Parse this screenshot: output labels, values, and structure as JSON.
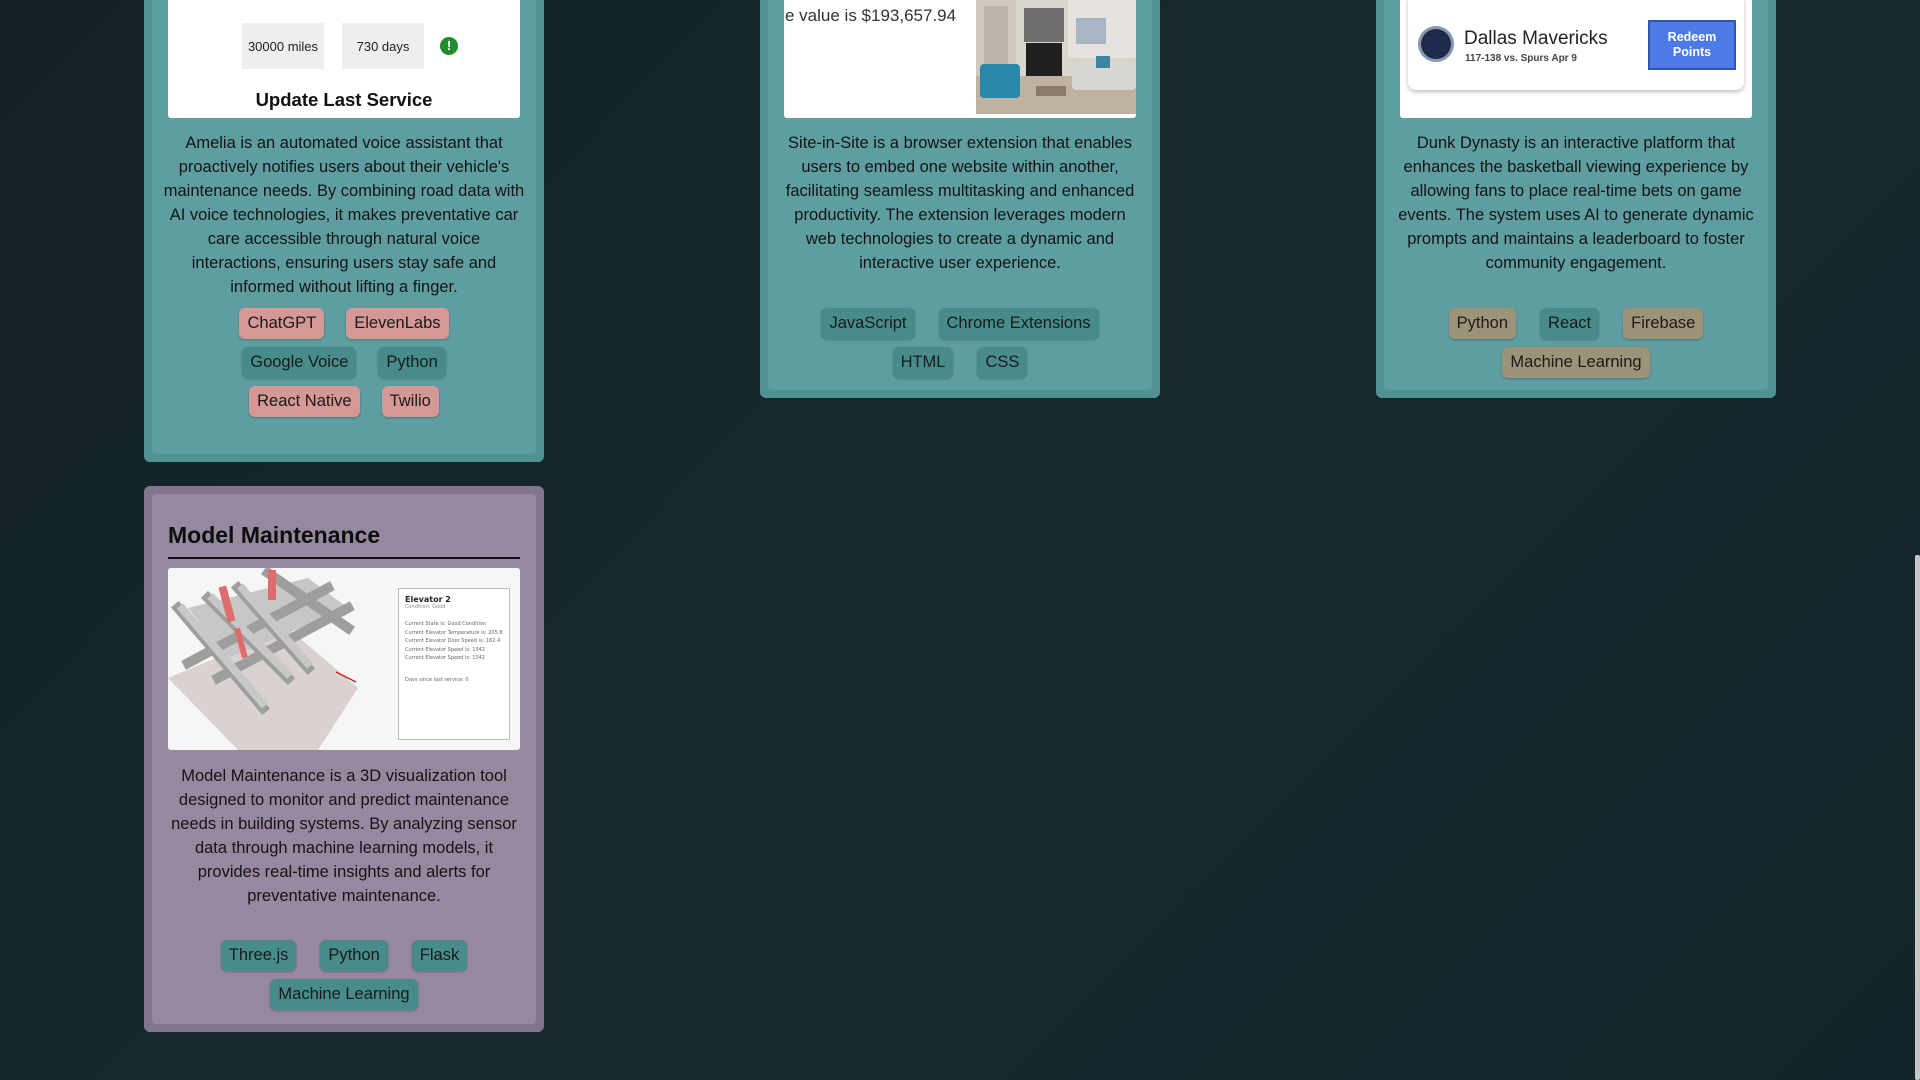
{
  "cards": {
    "amelia": {
      "preview": {
        "mileage": "30000 miles",
        "days": "730 days",
        "button": "Update Last Service"
      },
      "description": "Amelia is an automated voice assistant that proactively notifies users about their vehicle's maintenance needs. By combining road data with AI voice technologies, it makes preventative car care accessible through natural voice interactions, ensuring users stay safe and informed without lifting a finger.",
      "tags": [
        "ChatGPT",
        "ElevenLabs",
        "Google Voice",
        "Python",
        "React Native",
        "Twilio"
      ]
    },
    "site_in_site": {
      "preview": {
        "value_text": "e value is $193,657.94"
      },
      "description": "Site-in-Site is a browser extension that enables users to embed one website within another, facilitating seamless multitasking and enhanced productivity. The extension leverages modern web technologies to create a dynamic and interactive user experience.",
      "tags": [
        "JavaScript",
        "Chrome Extensions",
        "HTML",
        "CSS"
      ]
    },
    "dunk_dynasty": {
      "preview": {
        "team": "Dallas Mavericks",
        "score": "117-138 vs. Spurs Apr 9",
        "button": "Redeem Points"
      },
      "description": "Dunk Dynasty is an interactive platform that enhances the basketball viewing experience by allowing fans to place real-time bets on game events. The system uses AI to generate dynamic prompts and maintains a leaderboard to foster community engagement.",
      "tags": [
        "Python",
        "React",
        "Firebase",
        "Machine Learning"
      ]
    },
    "model_maintenance": {
      "title": "Model Maintenance",
      "preview": {
        "panel_title": "Elevator 2",
        "panel_subtitle": "Condition: Good",
        "panel_lines": [
          "Current State is: Good Condition",
          "Current Elevator Temperature is: 205.8",
          "Current Elevator Door Speed is: 162.4",
          "Current Elevator Speed is: 1342",
          "Current Elevator Speed is: 1342"
        ],
        "panel_footer": "Days since last service: 0"
      },
      "description": "Model Maintenance is a 3D visualization tool designed to monitor and predict maintenance needs in building systems. By analyzing sensor data through machine learning models, it provides real-time insights and alerts for preventative maintenance.",
      "tags": [
        "Three.js",
        "Python",
        "Flask",
        "Machine Learning"
      ]
    }
  },
  "colors": {
    "tag_pink": "#d49896",
    "tag_teal": "#478b8b",
    "tag_tan": "#9c9478",
    "tag_teal_dark": "#3f8484"
  }
}
